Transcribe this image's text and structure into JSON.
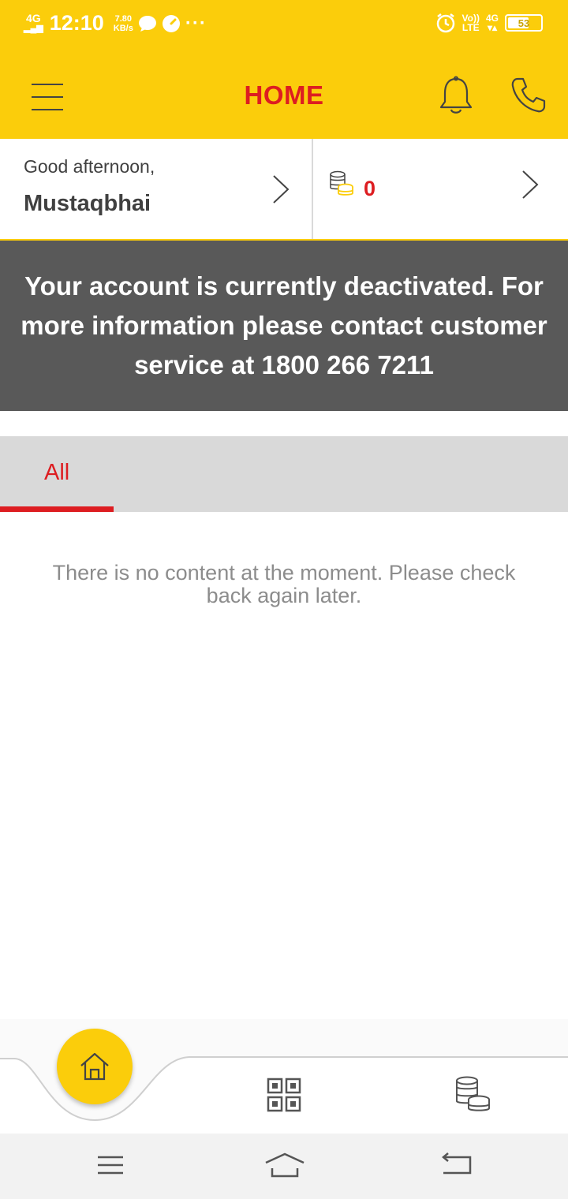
{
  "status_bar": {
    "network": "4G",
    "time": "12:10",
    "speed_value": "7.80",
    "speed_unit": "KB/s",
    "volte": "Vo))",
    "lte": "LTE",
    "network_right": "4G",
    "battery": "53"
  },
  "header": {
    "title": "HOME"
  },
  "greeting": {
    "label": "Good afternoon,",
    "name": "Mustaqbhai"
  },
  "points": {
    "value": "0"
  },
  "banner": {
    "message": "Your account is currently deactivated. For more information please contact customer service at 1800 266 7211"
  },
  "tabs": [
    {
      "label": "All",
      "selected": true
    }
  ],
  "empty_state": {
    "message": "There is no content at the moment. Please check back again later."
  },
  "bottom_nav": {
    "items": [
      {
        "icon": "home-icon",
        "active": true
      },
      {
        "icon": "qr-code-icon",
        "active": false
      },
      {
        "icon": "rewards-coins-icon",
        "active": false
      }
    ]
  },
  "colors": {
    "brand_yellow": "#fbcd0b",
    "brand_red": "#dd1d21",
    "banner_gray": "#595959",
    "tab_bg": "#d9d9d9",
    "text_dark": "#404040"
  }
}
